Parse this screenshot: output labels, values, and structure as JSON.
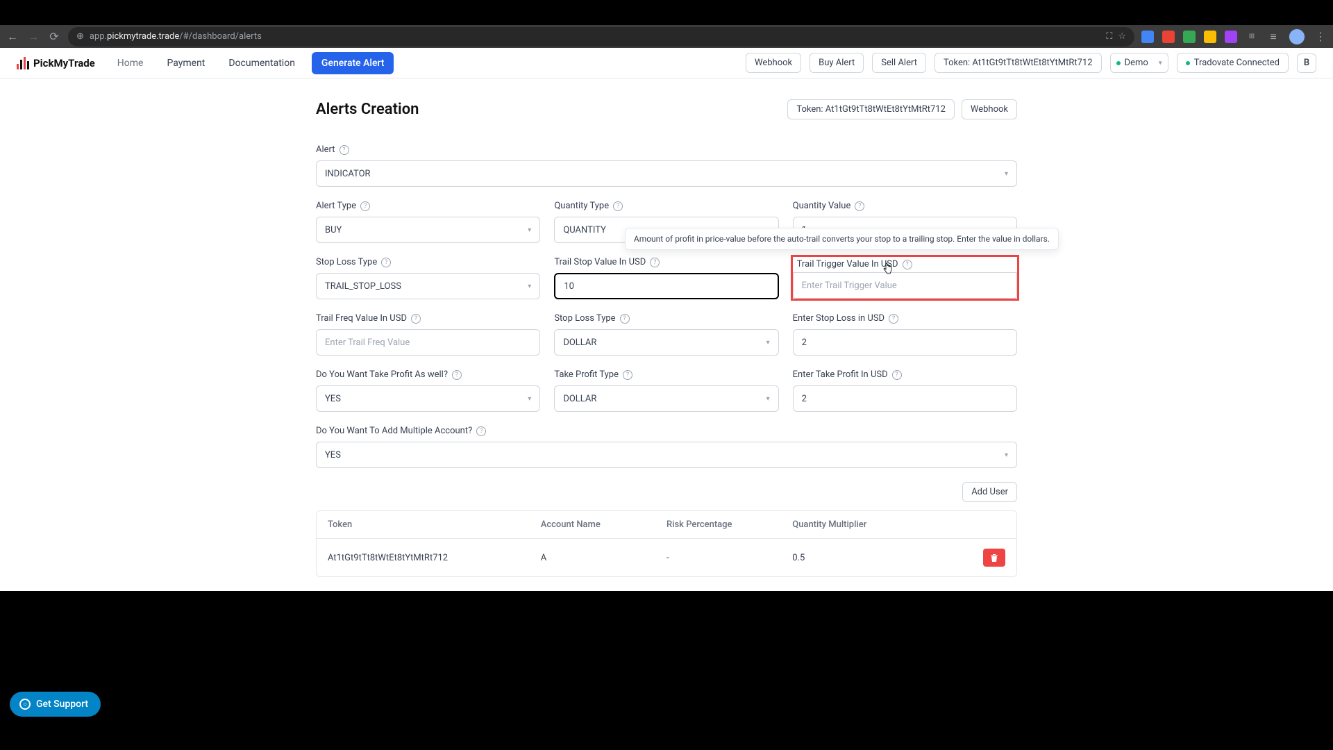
{
  "browser": {
    "url_prefix": "app.",
    "url_domain": "pickmytrade.trade",
    "url_path": "/#/dashboard/alerts"
  },
  "topbar": {
    "brand": "PickMyTrade",
    "nav": {
      "home": "Home",
      "payment": "Payment",
      "documentation": "Documentation",
      "generate": "Generate Alert"
    },
    "right": {
      "webhook": "Webhook",
      "buy_alert": "Buy Alert",
      "sell_alert": "Sell Alert",
      "token_label": "Token: At1tGt9tTt8tWtEt8tYtMtRt712",
      "account": "Demo",
      "connected": "Tradovate Connected",
      "user_initial": "B"
    }
  },
  "header": {
    "title": "Alerts Creation",
    "token_chip": "Token: At1tGt9tTt8tWtEt8tYtMtRt712",
    "webhook": "Webhook"
  },
  "form": {
    "alert": {
      "label": "Alert",
      "value": "INDICATOR"
    },
    "alert_type": {
      "label": "Alert Type",
      "value": "BUY"
    },
    "quantity_type": {
      "label": "Quantity Type",
      "value": "QUANTITY"
    },
    "quantity_value": {
      "label": "Quantity Value",
      "value": "1"
    },
    "stop_loss_type1": {
      "label": "Stop Loss Type",
      "value": "TRAIL_STOP_LOSS"
    },
    "trail_stop_value": {
      "label": "Trail Stop Value In USD",
      "value": "10"
    },
    "trail_trigger": {
      "label": "Trail Trigger Value In USD",
      "placeholder": "Enter Trail Trigger Value",
      "tooltip": "Amount of profit in price-value before the auto-trail converts your stop to a trailing stop. Enter the value in dollars."
    },
    "trail_freq": {
      "label": "Trail Freq Value In USD",
      "placeholder": "Enter Trail Freq Value"
    },
    "stop_loss_type2": {
      "label": "Stop Loss Type",
      "value": "DOLLAR"
    },
    "enter_stop_loss": {
      "label": "Enter Stop Loss in USD",
      "value": "2"
    },
    "take_profit_q": {
      "label": "Do You Want Take Profit As well?",
      "value": "YES"
    },
    "take_profit_type": {
      "label": "Take Profit Type",
      "value": "DOLLAR"
    },
    "enter_take_profit": {
      "label": "Enter Take Profit In USD",
      "value": "2"
    },
    "multi_account": {
      "label": "Do You Want To Add Multiple Account?",
      "value": "YES"
    }
  },
  "add_user": "Add User",
  "table": {
    "headers": {
      "token": "Token",
      "account": "Account Name",
      "risk": "Risk Percentage",
      "qty": "Quantity Multiplier"
    },
    "rows": [
      {
        "token": "At1tGt9tTt8tWtEt8tYtMtRt712",
        "account": "A",
        "risk": "-",
        "qty": "0.5"
      }
    ]
  },
  "support": "Get Support"
}
